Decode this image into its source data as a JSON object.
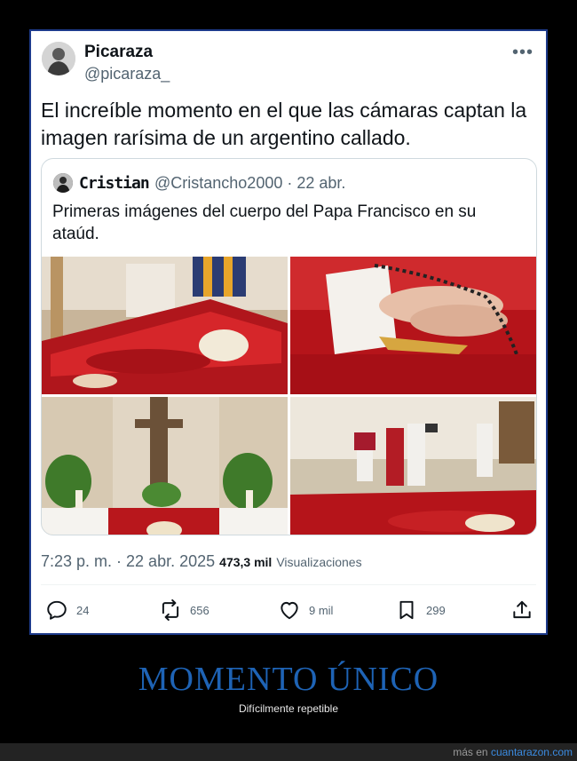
{
  "tweet": {
    "author_name": "Picaraza",
    "author_handle": "@picaraza_",
    "text": "El increíble momento en el que las cámaras captan la imagen rarísima de un argentino callado.",
    "more_icon": "more-dots-icon",
    "timestamp": "7:23 p. m. · 22 abr. 2025",
    "views_count": "473,3 mil",
    "views_label": "Visualizaciones"
  },
  "quote": {
    "author_name": "Cristian",
    "author_handle": "@Cristancho2000 · 22 abr.",
    "text": "Primeras imágenes del cuerpo del Papa Francisco en su ataúd."
  },
  "actions": {
    "reply": {
      "icon": "reply-icon",
      "count": "24"
    },
    "retweet": {
      "icon": "retweet-icon",
      "count": "656"
    },
    "like": {
      "icon": "heart-icon",
      "count": "9 mil"
    },
    "bookmark": {
      "icon": "bookmark-icon",
      "count": "299"
    },
    "share": {
      "icon": "share-icon"
    }
  },
  "caption": {
    "headline": "MOMENTO ÚNICO",
    "subline": "Difícilmente repetible"
  },
  "footer": {
    "prefix": "más en ",
    "site": "cuantarazon.com"
  },
  "colors": {
    "card_border": "#1d3a8a",
    "headline": "#1e63b5",
    "link": "#3b8be0",
    "coffin_red": "#c41a1f",
    "background": "#000000"
  }
}
